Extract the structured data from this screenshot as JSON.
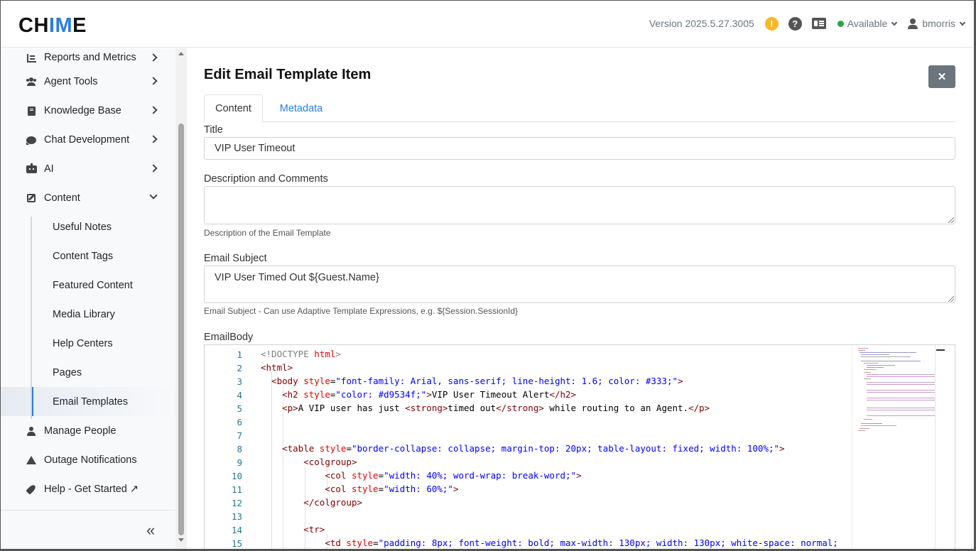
{
  "header": {
    "logo_prefix": "CH",
    "logo_mid": "IM",
    "logo_suffix": "E",
    "version": "Version 2025.5.27.3005",
    "warning_glyph": "!",
    "help_glyph": "?",
    "status": "Available",
    "username": "bmorris",
    "accent_color": "#2a7de1"
  },
  "sidebar": {
    "items": [
      {
        "label": "Reports and Metrics",
        "icon": "bar-chart-icon"
      },
      {
        "label": "Agent Tools",
        "icon": "people-icon"
      },
      {
        "label": "Knowledge Base",
        "icon": "book-icon"
      },
      {
        "label": "Chat Development",
        "icon": "chat-icon"
      },
      {
        "label": "AI",
        "icon": "robot-icon"
      },
      {
        "label": "Content",
        "icon": "edit-icon"
      }
    ],
    "content_children": [
      "Useful Notes",
      "Content Tags",
      "Featured Content",
      "Media Library",
      "Help Centers",
      "Pages",
      "Email Templates"
    ],
    "bottom_items": [
      {
        "label": "Manage People",
        "icon": "user-icon"
      },
      {
        "label": "Outage Notifications",
        "icon": "warning-icon"
      },
      {
        "label": "Help - Get Started ↗",
        "icon": "rocket-icon"
      }
    ],
    "collapse_glyph": "«"
  },
  "main": {
    "title": "Edit Email Template Item",
    "close_glyph": "✕",
    "tabs": [
      "Content",
      "Metadata"
    ],
    "fields": {
      "title_label": "Title",
      "title_value": "VIP User Timeout",
      "description_label": "Description and Comments",
      "description_value": "",
      "description_help": "Description of the Email Template",
      "subject_label": "Email Subject",
      "subject_value": "VIP User Timed Out ${Guest.Name}",
      "subject_help": "Email Subject - Can use Adaptive Template Expressions, e.g. ${Session.SessionId}",
      "body_label": "EmailBody"
    },
    "code_lines": [
      "1",
      "2",
      "3",
      "4",
      "5",
      "6",
      "7",
      "8",
      "9",
      "10",
      "11",
      "12",
      "13",
      "14",
      "15"
    ]
  }
}
